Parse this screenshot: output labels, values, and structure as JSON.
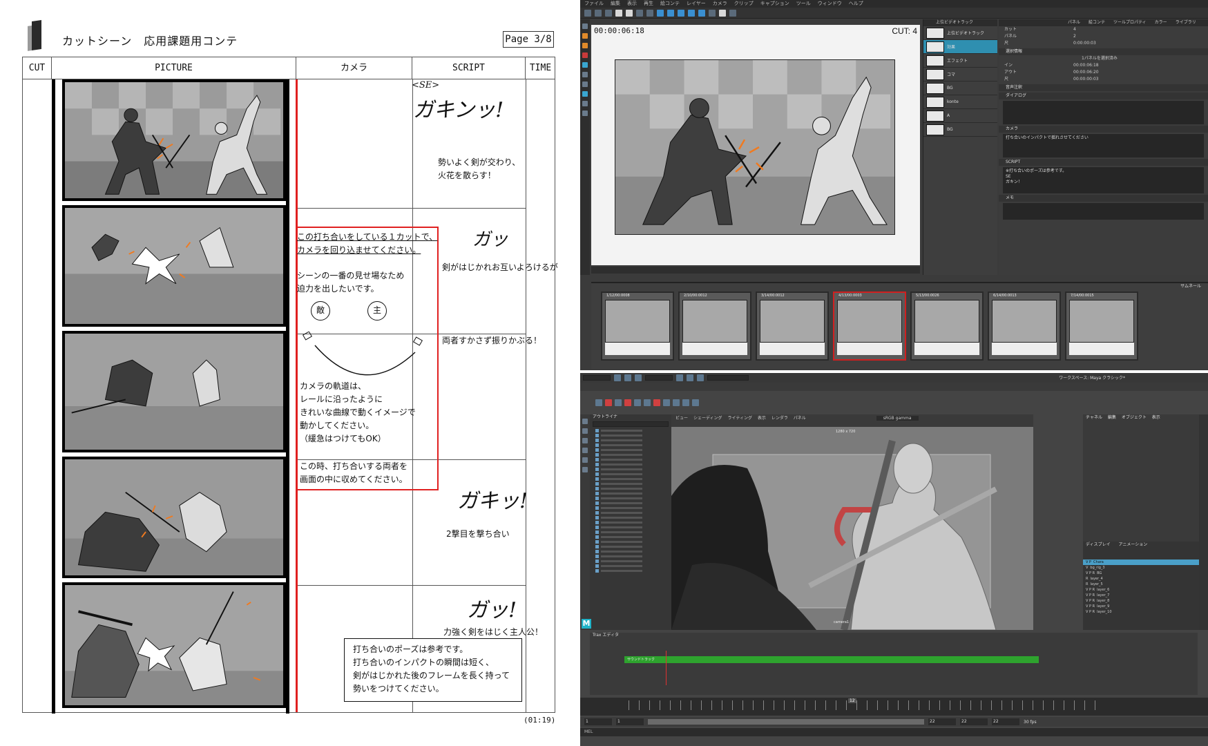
{
  "sheet": {
    "title": "カットシーン　応用課題用コンテ",
    "page": "Page 3/8",
    "headers": [
      "CUT",
      "PICTURE",
      "カメラ",
      "SCRIPT",
      "TIME"
    ],
    "camera_notes": [
      "この打ち合いをしている１カットで、\nカメラを回り込ませてください。",
      "シーンの一番の見せ場なため\n迫力を出したいです。",
      "カメラの軌道は、\nレールに沿ったように\nきれいな曲線で動くイメージで\n動かしてください。\n（緩急はつけてもOK）",
      "この時、打ち合いする両者を\n画面の中に収めてください。"
    ],
    "circle_labels": [
      "敵",
      "主"
    ],
    "se_tag": "<SE>",
    "sfx": [
      "ガキンッ!",
      "ガッ",
      "ガキッ!",
      "ガッ!"
    ],
    "script_lines": [
      "勢いよく剣が交わり、\n火花を散らす！",
      "剣がはじかれお互いよろけるが",
      "両者すかさず振りかぶる！",
      "2撃目を撃ち合い",
      "力強く剣をはじく主人公！"
    ],
    "note": "打ち合いのポーズは参考です。\n打ち合いのインパクトの瞬間は短く、\n剣がはじかれた後のフレームを長く持って\n勢いをつけてください。",
    "duration": "(01:19)"
  },
  "storyboard_app": {
    "menu": [
      "ファイル",
      "編集",
      "表示",
      "再生",
      "絵コンテ",
      "レイヤー",
      "カメラ",
      "クリップ",
      "キャプション",
      "ツール",
      "ウィンドウ",
      "ヘルプ"
    ],
    "timecode": "00:00:06:18",
    "cut": "CUT: 4",
    "layers": [
      "上位ビデオトラック",
      "効果",
      "エフェクト",
      "コマ",
      "BG",
      "konte",
      "A",
      "BG"
    ],
    "prop_tabs": [
      "パネル",
      "絵コンテ",
      "ツールプロパティ",
      "カラー",
      "ライブラリ"
    ],
    "prop_rows": [
      {
        "label": "カット",
        "value": "4"
      },
      {
        "label": "パネル",
        "value": "2"
      },
      {
        "label": "尺",
        "value": "0:00:00:03"
      }
    ],
    "selection_label": "選択情報",
    "selection_info": "1パネルを選択済み",
    "in_out": [
      {
        "label": "イン",
        "value": "00:00:06:18"
      },
      {
        "label": "アウト",
        "value": "00:00:06:20"
      },
      {
        "label": "尺",
        "value": "00:00:00:03"
      }
    ],
    "audio_note_label": "音声注釈",
    "dialogue_label": "ダイアログ",
    "camera_label": "カメラ",
    "camera_text": "打ち合いのインパクトで揺れさせてください",
    "script_label": "SCRIPT",
    "script_text": "※打ち合いのポーズは参考です。\nSE\nガキン！",
    "memo_label": "メモ",
    "thumbnails_label": "サムネール",
    "thumbnails": [
      "1/12/00:0008",
      "2/10/00:0012",
      "3/14/00:0012",
      "4/13/00:0003",
      "5/13/00:0026",
      "6/14/00:0013",
      "7/14/00:0015"
    ]
  },
  "maya_app": {
    "workspace": "ワークスペース: Maya クラシック*",
    "outliner_label": "アウトライナ",
    "viewport_menu": [
      "ビュー",
      "シェーディング",
      "ライティング",
      "表示",
      "レンダラ",
      "パネル"
    ],
    "resolution": "1280 x 720",
    "camera_name": "camera1",
    "gamma": "sRGB gamma",
    "channel_menu": [
      "チャネル",
      "編集",
      "オブジェクト",
      "表示"
    ],
    "display_tabs": [
      "ディスプレイ",
      "アニメーション"
    ],
    "layer_rows": [
      "Chara",
      "bg_rig_3",
      "BG",
      "layer_4",
      "layer_5",
      "layer_6",
      "layer_7",
      "layer_8",
      "layer_9",
      "layer_10"
    ],
    "trax_label": "Trax エディタ",
    "trax_track": "サウンドトラック",
    "current_frame": "12",
    "range": [
      "1",
      "1",
      "22",
      "22",
      "22"
    ],
    "fps": "30 fps",
    "mel": "MEL"
  }
}
